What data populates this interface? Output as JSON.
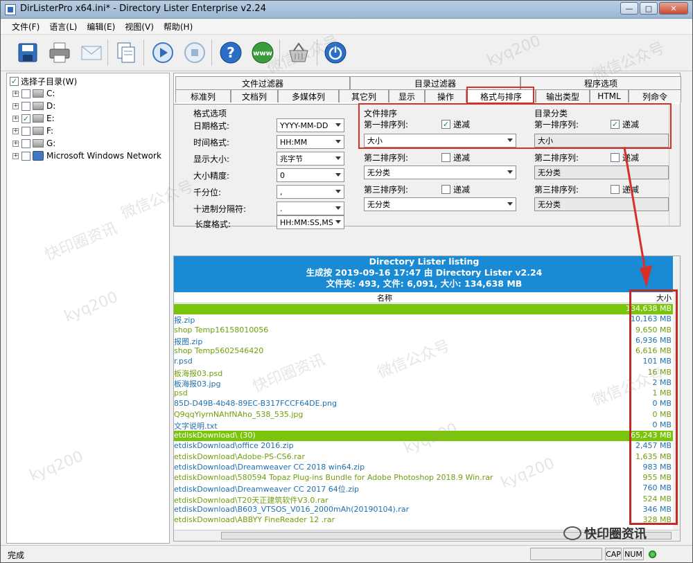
{
  "window": {
    "title": "DirListerPro x64.ini* - Directory Lister Enterprise v2.24"
  },
  "menu": [
    "文件(F)",
    "语言(L)",
    "编辑(E)",
    "视图(V)",
    "帮助(H)"
  ],
  "toolbar": [
    "save-icon",
    "print-icon",
    "email-icon",
    "copy-icon",
    "run-icon",
    "stop-icon",
    "help-icon",
    "web-icon",
    "basket-icon",
    "power-icon"
  ],
  "tree": {
    "root": "选择子目录(W)",
    "items": [
      {
        "label": "C:",
        "checked": false
      },
      {
        "label": "D:",
        "checked": false
      },
      {
        "label": "E:",
        "checked": true
      },
      {
        "label": "F:",
        "checked": false
      },
      {
        "label": "G:",
        "checked": false
      },
      {
        "label": "Microsoft Windows Network",
        "checked": false
      }
    ]
  },
  "tabs": {
    "row1": [
      "文件过滤器",
      "目录过滤器",
      "程序选项"
    ],
    "row2": [
      "标准列",
      "文档列",
      "多媒体列",
      "其它列",
      "显示",
      "操作",
      "格式与排序",
      "输出类型",
      "HTML",
      "列命令"
    ],
    "active": "格式与排序"
  },
  "format": {
    "group": "格式选项",
    "rows": [
      {
        "label": "日期格式:",
        "value": "YYYY-MM-DD"
      },
      {
        "label": "时间格式:",
        "value": "HH:MM"
      },
      {
        "label": "显示大小:",
        "value": "兆字节"
      },
      {
        "label": "大小精度:",
        "value": "0"
      },
      {
        "label": "千分位:",
        "value": ","
      },
      {
        "label": "十进制分隔符:",
        "value": "."
      },
      {
        "label": "长度格式:",
        "value": "HH:MM:SS,MS"
      }
    ]
  },
  "file_sort": {
    "group": "文件排序",
    "rows": [
      {
        "label": "第一排序列:",
        "desc_label": "递减",
        "desc": true,
        "value": "大小"
      },
      {
        "label": "第二排序列:",
        "desc_label": "递减",
        "desc": false,
        "value": "无分类"
      },
      {
        "label": "第三排序列:",
        "desc_label": "递减",
        "desc": false,
        "value": "无分类"
      }
    ]
  },
  "dir_sort": {
    "group": "目录分类",
    "rows": [
      {
        "label": "第一排序列:",
        "desc_label": "递减",
        "desc": true,
        "value": "大小"
      },
      {
        "label": "第二排序列:",
        "desc_label": "递减",
        "desc": false,
        "value": "无分类"
      },
      {
        "label": "第三排序列:",
        "desc_label": "递减",
        "desc": false,
        "value": "无分类"
      }
    ]
  },
  "listing": {
    "heading": "Directory Lister listing",
    "generated": "生成按 2019-09-16 17:47 由 Directory Lister v2.24",
    "summary": "文件夹: 493, 文件: 6,091, 大小: 134,638 MB",
    "col_name": "名称",
    "col_size": "大小",
    "rows": [
      {
        "name": "",
        "size": "134,638 MB",
        "type": "green"
      },
      {
        "name": "报.zip",
        "size": "10,163 MB",
        "type": "odd"
      },
      {
        "name": "shop Temp16158010056",
        "size": "9,650 MB",
        "type": "even"
      },
      {
        "name": "报图.zip",
        "size": "6,936 MB",
        "type": "odd"
      },
      {
        "name": "shop Temp5602546420",
        "size": "6,616 MB",
        "type": "even"
      },
      {
        "name": "r.psd",
        "size": "101 MB",
        "type": "odd"
      },
      {
        "name": "板海报03.psd",
        "size": "16 MB",
        "type": "even"
      },
      {
        "name": "板海报03.jpg",
        "size": "2 MB",
        "type": "odd"
      },
      {
        "name": "psd",
        "size": "1 MB",
        "type": "even"
      },
      {
        "name": "85D-D49B-4b48-89EC-B317FCCF64DE.png",
        "size": "0 MB",
        "type": "odd"
      },
      {
        "name": "Q9qqYiyrnNAhfNAho_538_535.jpg",
        "size": "0 MB",
        "type": "even"
      },
      {
        "name": "文字说明.txt",
        "size": "0 MB",
        "type": "odd"
      },
      {
        "name": "etdiskDownload\\ (30)",
        "size": "65,243 MB",
        "type": "green"
      },
      {
        "name": "etdiskDownload\\office 2016.zip",
        "size": "2,457 MB",
        "type": "odd"
      },
      {
        "name": "etdiskDownload\\Adobe-PS-CS6.rar",
        "size": "1,635 MB",
        "type": "even"
      },
      {
        "name": "etdiskDownload\\Dreamweaver CC 2018 win64.zip",
        "size": "983 MB",
        "type": "odd"
      },
      {
        "name": "etdiskDownload\\580594 Topaz Plug-ins Bundle for Adobe Photoshop 2018.9 Win.rar",
        "size": "955 MB",
        "type": "even"
      },
      {
        "name": "etdiskDownload\\Dreamweaver CC 2017 64位.zip",
        "size": "760 MB",
        "type": "odd"
      },
      {
        "name": "etdiskDownload\\T20天正建筑软件V3.0.rar",
        "size": "524 MB",
        "type": "even"
      },
      {
        "name": "etdiskDownload\\B603_VTSOS_V016_2000mAh(20190104).rar",
        "size": "346 MB",
        "type": "odd"
      },
      {
        "name": "etdiskDownload\\ABBYY FineReader 12 .rar",
        "size": "328 MB",
        "type": "even"
      }
    ]
  },
  "status": {
    "text": "完成",
    "cap": "CAP",
    "num": "NUM"
  },
  "watermarks": [
    "kyq200",
    "微信公众号",
    "快印圈资讯"
  ],
  "brand": "快印圈资讯"
}
